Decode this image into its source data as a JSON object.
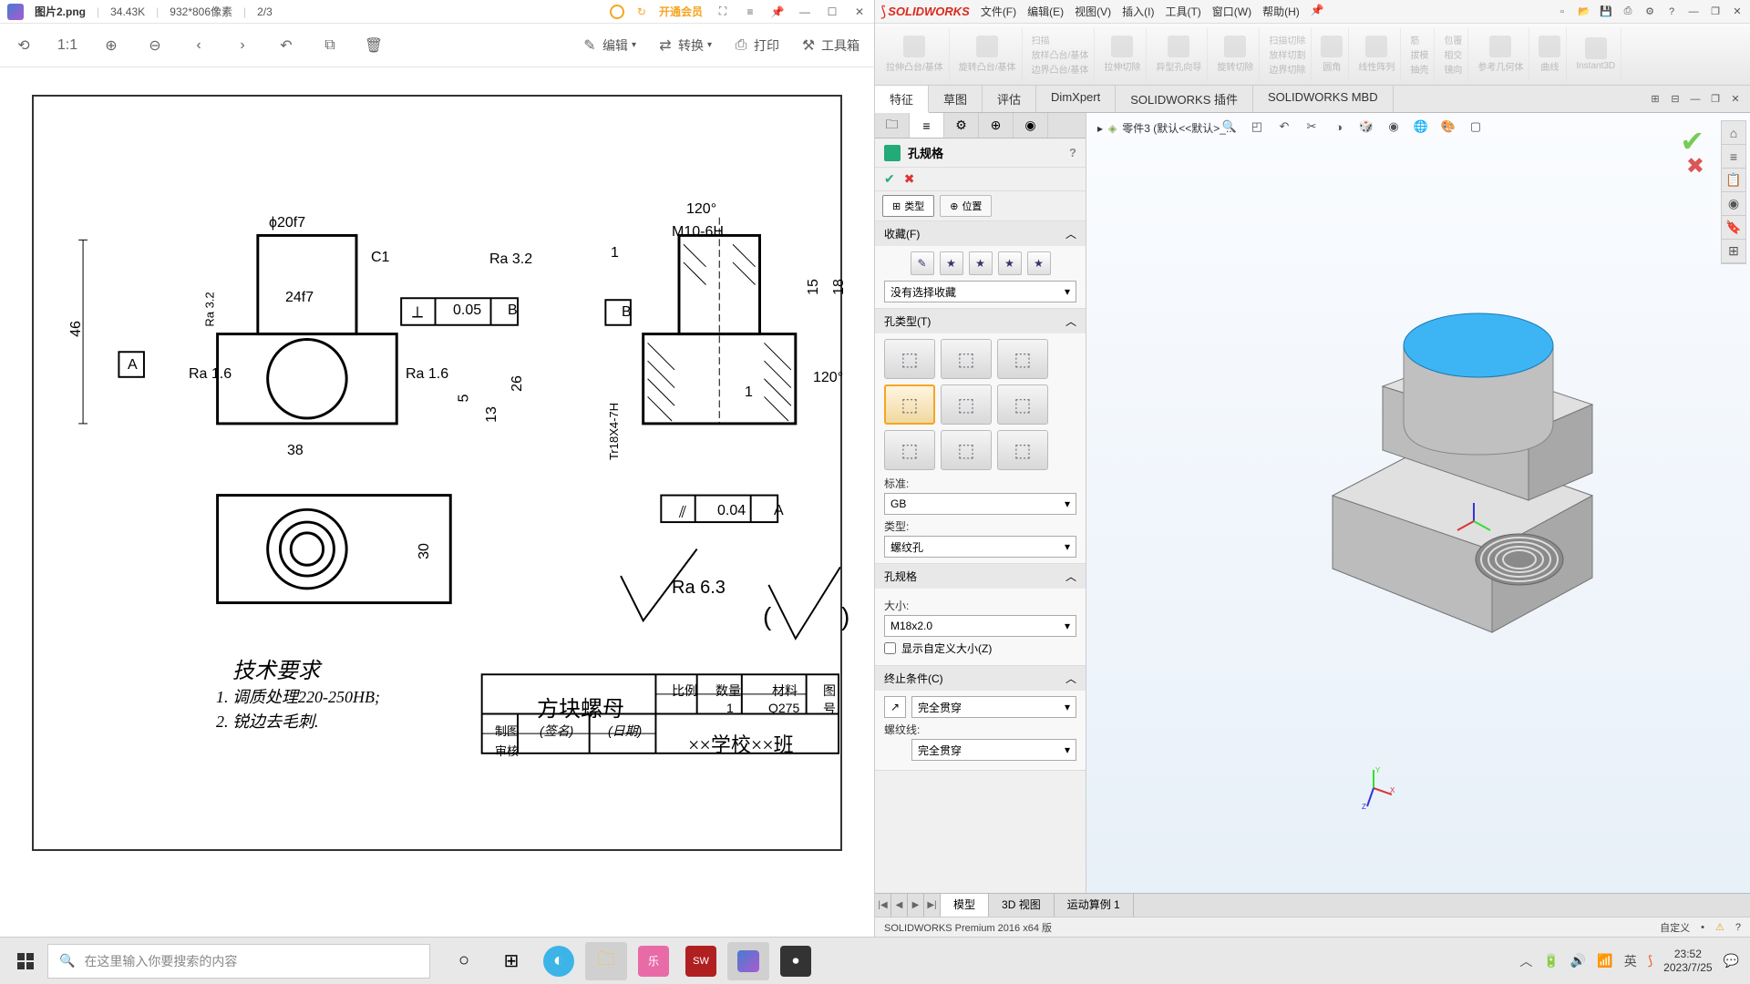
{
  "imageViewer": {
    "fileName": "图片2.png",
    "fileSize": "34.43K",
    "dimensions": "932*806像素",
    "pageIndicator": "2/3",
    "vipLabel": "开通会员",
    "toolbar": {
      "edit": "编辑",
      "convert": "转换",
      "print": "打印",
      "toolbox": "工具箱"
    }
  },
  "drawing": {
    "dim_phi20f7": "ϕ20f7",
    "dim_C1": "C1",
    "dim_Ra32": "Ra 3.2",
    "dim_24f7": "24f7",
    "dim_005": "0.05",
    "dim_B": "B",
    "dim_A": "A",
    "dim_Ra16": "Ra 1.6",
    "dim_Ra16b": "Ra 1.6",
    "dim_46": "46",
    "dim_Ra32v": "Ra 3.2",
    "dim_5": "5",
    "dim_13": "13",
    "dim_26": "26",
    "dim_38": "38",
    "dim_30": "30",
    "dim_120a": "120°",
    "dim_M10": "M10-6H",
    "dim_1": "1",
    "dim_15": "15",
    "dim_18": "18",
    "dim_120b": "120°",
    "dim_1b": "1",
    "dim_004": "0.04",
    "dim_Ab": "A",
    "dim_Tr18": "Tr18X4-7H",
    "dim_Ra63": "Ra 6.3",
    "tech_title": "技术要求",
    "tech_1": "1. 调质处理220-250HB;",
    "tech_2": "2. 锐边去毛刺.",
    "tb_title": "方块螺母",
    "tb_ratio": "比例",
    "tb_qty": "数量",
    "tb_mat": "材料",
    "tb_no": "图号",
    "tb_qty_val": "1",
    "tb_mat_val": "Q275",
    "tb_draw": "制图",
    "tb_check": "审核",
    "tb_sign": "(签名)",
    "tb_date": "(日期)",
    "tb_school": "××学校××班"
  },
  "solidworks": {
    "logo": "SOLIDWORKS",
    "menu": [
      "文件(F)",
      "编辑(E)",
      "视图(V)",
      "插入(I)",
      "工具(T)",
      "窗口(W)",
      "帮助(H)"
    ],
    "ribbon": [
      "拉伸凸台/基体",
      "旋转凸台/基体",
      "扫描",
      "放样凸台/基体",
      "边界凸台/基体",
      "拉伸切除",
      "异型孔向导",
      "旋转切除",
      "扫描切除",
      "放样切割",
      "边界切除",
      "圆角",
      "线性阵列",
      "筋",
      "拔模",
      "抽壳",
      "包覆",
      "相交",
      "镜向",
      "参考几何体",
      "曲线",
      "Instant3D"
    ],
    "tabs": [
      "特征",
      "草图",
      "评估",
      "DimXpert",
      "SOLIDWORKS 插件",
      "SOLIDWORKS MBD"
    ],
    "activeTab": "特征",
    "breadcrumb": "零件3  (默认<<默认>_...",
    "feature": {
      "title": "孔规格",
      "subtabs": {
        "type": "类型",
        "position": "位置"
      },
      "favorites": {
        "header": "收藏(F)",
        "dropdown": "没有选择收藏"
      },
      "holeType": {
        "header": "孔类型(T)",
        "standard_label": "标准:",
        "standard_val": "GB",
        "type_label": "类型:",
        "type_val": "螺纹孔"
      },
      "holeSpec": {
        "header": "孔规格",
        "size_label": "大小:",
        "size_val": "M18x2.0",
        "custom_label": "显示自定义大小(Z)"
      },
      "endCond": {
        "header": "终止条件(C)",
        "val": "完全贯穿",
        "thread_label": "螺纹线:",
        "thread_val": "完全贯穿"
      }
    },
    "bottomTabs": [
      "模型",
      "3D 视图",
      "运动算例 1"
    ],
    "status": "SOLIDWORKS Premium 2016 x64 版",
    "statusCustom": "自定义"
  },
  "taskbar": {
    "searchPlaceholder": "在这里输入你要搜索的内容",
    "time": "23:52",
    "date": "2023/7/25"
  }
}
